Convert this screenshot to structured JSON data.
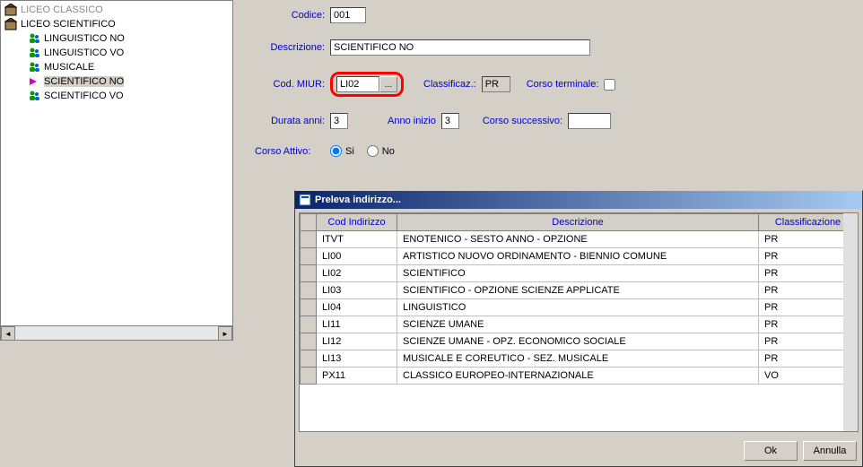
{
  "tree": {
    "root_partial": "LICEO CLASSICO",
    "root2": "LICEO SCIENTIFICO",
    "items": [
      "LINGUISTICO NO",
      "LINGUISTICO VO",
      "MUSICALE",
      "SCIENTIFICO NO",
      "SCIENTIFICO VO"
    ],
    "selected_index": 3
  },
  "form": {
    "codice_label": "Codice:",
    "codice": "001",
    "descrizione_label": "Descrizione:",
    "descrizione": "SCIENTIFICO NO",
    "cod_miur_label": "Cod. MIUR:",
    "cod_miur": "LI02",
    "dots": "...",
    "classificaz_label": "Classificaz.:",
    "classificaz": "PR",
    "corso_terminale_label": "Corso terminale:",
    "durata_anni_label": "Durata anni:",
    "durata_anni": "3",
    "anno_inizio_label": "Anno inizio",
    "anno_inizio": "3",
    "corso_successivo_label": "Corso successivo:",
    "corso_successivo": "",
    "corso_attivo_label": "Corso Attivo:",
    "si": "Si",
    "no": "No"
  },
  "dialog": {
    "title": "Preleva indirizzo...",
    "headers": {
      "cod": "Cod Indirizzo",
      "desc": "Descrizione",
      "class": "Classificazione"
    },
    "rows": [
      {
        "cod": "ITVT",
        "desc": "ENOTENICO - SESTO ANNO - OPZIONE",
        "class": "PR"
      },
      {
        "cod": "LI00",
        "desc": "ARTISTICO NUOVO ORDINAMENTO - BIENNIO COMUNE",
        "class": "PR"
      },
      {
        "cod": "LI02",
        "desc": "SCIENTIFICO",
        "class": "PR"
      },
      {
        "cod": "LI03",
        "desc": "SCIENTIFICO -  OPZIONE SCIENZE APPLICATE",
        "class": "PR"
      },
      {
        "cod": "LI04",
        "desc": "LINGUISTICO",
        "class": "PR"
      },
      {
        "cod": "LI11",
        "desc": "SCIENZE UMANE",
        "class": "PR"
      },
      {
        "cod": "LI12",
        "desc": "SCIENZE UMANE  - OPZ. ECONOMICO SOCIALE",
        "class": "PR"
      },
      {
        "cod": "LI13",
        "desc": "MUSICALE E COREUTICO - SEZ. MUSICALE",
        "class": "PR"
      },
      {
        "cod": "PX11",
        "desc": "CLASSICO EUROPEO-INTERNAZIONALE",
        "class": "VO"
      }
    ],
    "ok": "Ok",
    "annulla": "Annulla"
  }
}
